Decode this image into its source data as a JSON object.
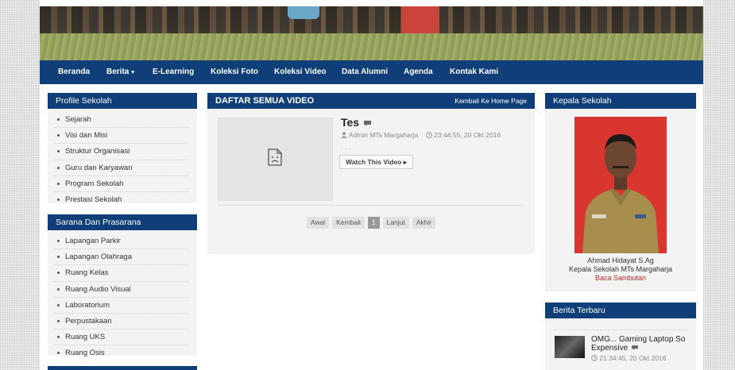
{
  "nav": {
    "items": [
      "Beranda",
      "Berita",
      "E-Learning",
      "Koleksi Foto",
      "Koleksi Video",
      "Data Alumni",
      "Agenda",
      "Kontak Kami"
    ],
    "berita_caret": "▾"
  },
  "profile": {
    "title": "Profile Sekolah",
    "items": [
      "Sejarah",
      "Visi dan Misi",
      "Struktur Organisasi",
      "Guru dan Karyawan",
      "Program Sekolah",
      "Prestasi Sekolah"
    ]
  },
  "sarana": {
    "title": "Sarana Dan Prasarana",
    "items": [
      "Lapangan Parkir",
      "Lapangan Olahraga",
      "Ruang Kelas",
      "Ruang Audio Visual",
      "Laboratorium",
      "Perpustakaan",
      "Ruang UKS",
      "Ruang Osis"
    ]
  },
  "main": {
    "title": "DAFTAR SEMUA VIDEO",
    "back_link": "Kembali Ke Home Page",
    "video": {
      "title": "Tes",
      "author": "Admin MTs Margaharja",
      "datetime": "23:44:55, 20 Okt 2016",
      "excerpt": ". . .",
      "watch_label": "Watch This Video ▸"
    },
    "pagination": [
      "Awal",
      "Kembali",
      "1",
      "Lanjut",
      "Akhir"
    ],
    "current_page": "1"
  },
  "kepala": {
    "title": "Kepala Sekolah",
    "name": "Ahmad Hidayat S.Ag",
    "role": "Kepala Sekolah MTs Margaharja",
    "link": "Baca Sambutan"
  },
  "berita": {
    "title": "Berita Terbaru",
    "item": {
      "title": "OMG... Gaming Laptop So Expensive",
      "datetime": "21:34:45, 20 Okt 2016"
    }
  },
  "colors": {
    "navy": "#0f3e78",
    "link_red": "#c0282b"
  }
}
